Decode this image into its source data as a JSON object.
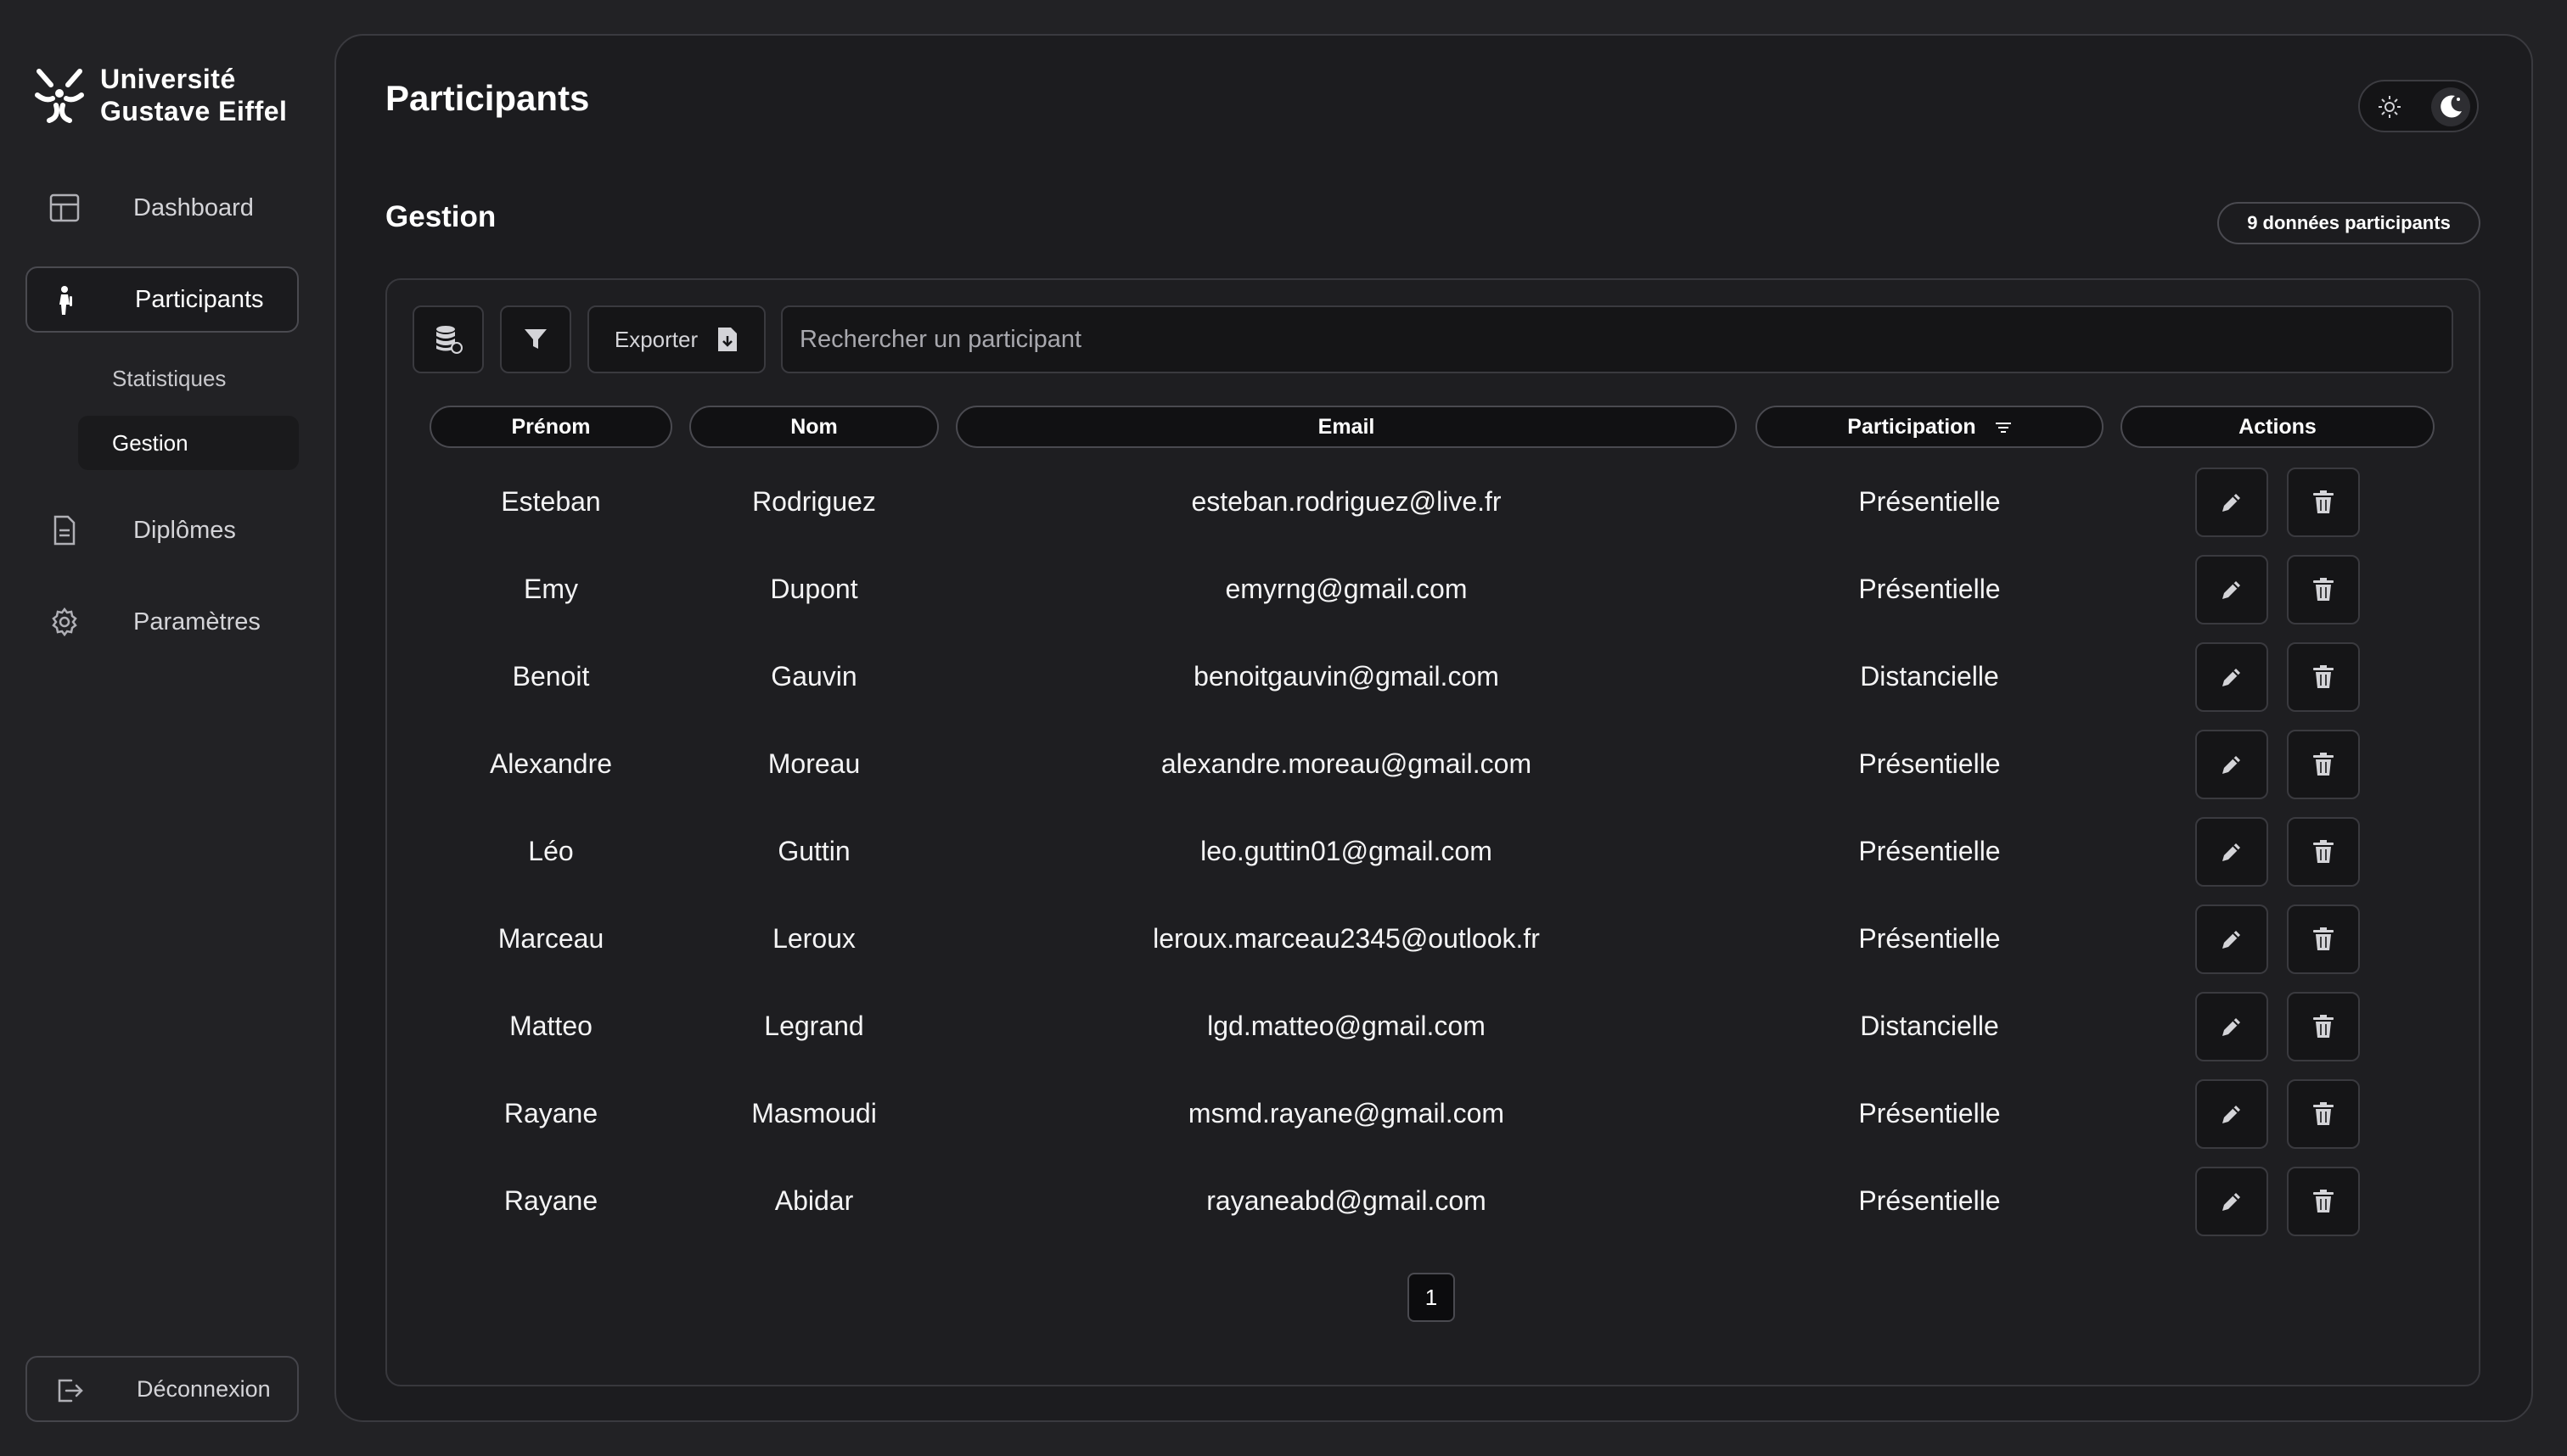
{
  "brand": {
    "line1": "Université",
    "line2": "Gustave Eiffel"
  },
  "sidebar": {
    "items": [
      {
        "label": "Dashboard",
        "icon": "layout-icon"
      },
      {
        "label": "Participants",
        "icon": "person-walking-icon"
      },
      {
        "label": "Diplômes",
        "icon": "document-icon"
      },
      {
        "label": "Paramètres",
        "icon": "gear-icon"
      }
    ],
    "subitems": [
      {
        "label": "Statistiques"
      },
      {
        "label": "Gestion"
      }
    ],
    "logout": "Déconnexion"
  },
  "header": {
    "title": "Participants"
  },
  "theme": {
    "options": [
      "light",
      "dark"
    ],
    "selected": "dark"
  },
  "section": {
    "title": "Gestion",
    "badge": "9 données participants"
  },
  "toolbar": {
    "export_label": "Exporter",
    "search_placeholder": "Rechercher un participant"
  },
  "table": {
    "headers": {
      "firstname": "Prénom",
      "lastname": "Nom",
      "email": "Email",
      "participation": "Participation",
      "actions": "Actions"
    },
    "rows": [
      {
        "firstname": "Esteban",
        "lastname": "Rodriguez",
        "email": "esteban.rodriguez@live.fr",
        "participation": "Présentielle"
      },
      {
        "firstname": "Emy",
        "lastname": "Dupont",
        "email": "emyrng@gmail.com",
        "participation": "Présentielle"
      },
      {
        "firstname": "Benoit",
        "lastname": "Gauvin",
        "email": "benoitgauvin@gmail.com",
        "participation": "Distancielle"
      },
      {
        "firstname": "Alexandre",
        "lastname": "Moreau",
        "email": "alexandre.moreau@gmail.com",
        "participation": "Présentielle"
      },
      {
        "firstname": "Léo",
        "lastname": "Guttin",
        "email": "leo.guttin01@gmail.com",
        "participation": "Présentielle"
      },
      {
        "firstname": "Marceau",
        "lastname": "Leroux",
        "email": "leroux.marceau2345@outlook.fr",
        "participation": "Présentielle"
      },
      {
        "firstname": "Matteo",
        "lastname": "Legrand",
        "email": "lgd.matteo@gmail.com",
        "participation": "Distancielle"
      },
      {
        "firstname": "Rayane",
        "lastname": "Masmoudi",
        "email": "msmd.rayane@gmail.com",
        "participation": "Présentielle"
      },
      {
        "firstname": "Rayane",
        "lastname": "Abidar",
        "email": "rayaneabd@gmail.com",
        "participation": "Présentielle"
      }
    ]
  },
  "pagination": {
    "current": "1"
  },
  "colors": {
    "background": "#222225",
    "panel": "#1c1c1f",
    "border": "#3a3a3f",
    "text": "#ffffff"
  }
}
